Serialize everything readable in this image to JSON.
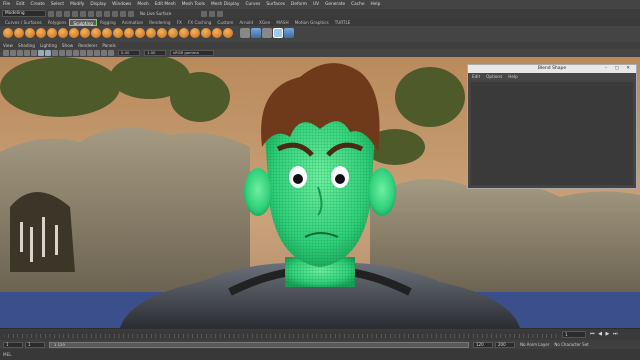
{
  "menubar": [
    "File",
    "Edit",
    "Create",
    "Select",
    "Modify",
    "Display",
    "Windows",
    "Mesh",
    "Edit Mesh",
    "Mesh Tools",
    "Mesh Display",
    "Curves",
    "Surfaces",
    "Deform",
    "UV",
    "Generate",
    "Cache",
    "Help"
  ],
  "status": {
    "mode": "Modeling",
    "no_live": "No Live Surface"
  },
  "shelf_tabs": [
    "Curves / Surfaces",
    "Polygons",
    "Sculpting",
    "Rigging",
    "Animation",
    "Rendering",
    "FX",
    "FX Caching",
    "Custom",
    "Arnold",
    "XGen",
    "MASH",
    "Motion Graphics",
    "TURTLE"
  ],
  "shelf_active": "Sculpting",
  "viewport_menu": [
    "View",
    "Shading",
    "Lighting",
    "Show",
    "Renderer",
    "Panels"
  ],
  "viewport_fields": {
    "a": "0.00",
    "b": "1.00",
    "gamma": "sRGB gamma"
  },
  "blend_window": {
    "title": "Blend Shape",
    "menus": [
      "Edit",
      "Options",
      "Help"
    ],
    "controls": "–  ▢  ✕"
  },
  "timeline": {
    "current": "1",
    "play": "⏮ ◀ ▶ ⏭"
  },
  "range": {
    "start": "1",
    "inner_start": "1",
    "slider": "1          120",
    "inner_end": "120",
    "end": "200",
    "anim_layer": "No Anim Layer",
    "char_set": "No Character Set"
  },
  "cmd": {
    "label": "MEL"
  },
  "colors": {
    "shelf_accent": "#7ac77a",
    "mesh_green": "#2fe07a"
  }
}
